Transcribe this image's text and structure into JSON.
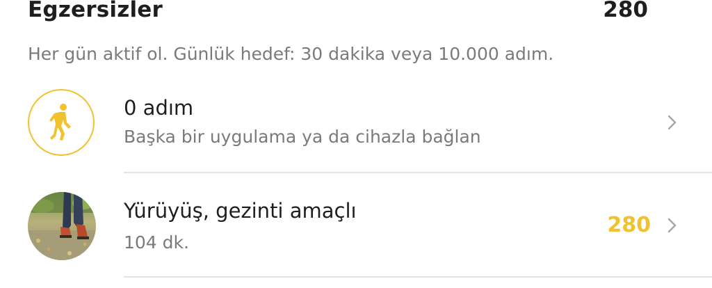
{
  "section": {
    "title": "Egzersizler",
    "total": "280",
    "description": "Her gün aktif ol. Günlük hedef: 30 dakika veya 10.000 adım."
  },
  "rows": [
    {
      "icon": "walking-person-icon",
      "title": "0 adım",
      "subtitle": "Başka bir uygulama ya da cihazla bağlan",
      "points": ""
    },
    {
      "icon": "walking-photo",
      "title": "Yürüyüş, gezinti amaçlı",
      "subtitle": "104 dk.",
      "points": "280"
    }
  ],
  "colors": {
    "accent": "#f2c12e",
    "text_primary": "#1e1e1e",
    "text_secondary": "#7a7a7a",
    "divider": "#e2e2e2",
    "chevron": "#a6a6a6"
  }
}
